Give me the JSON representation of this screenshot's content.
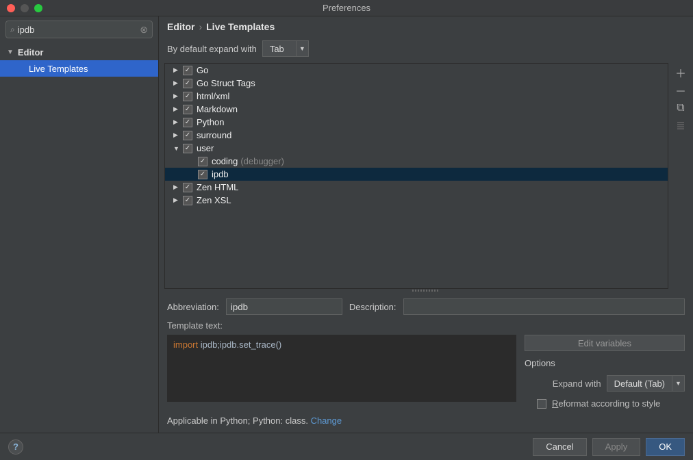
{
  "window": {
    "title": "Preferences"
  },
  "search": {
    "value": "ipdb",
    "placeholder": ""
  },
  "sidebar": {
    "group": "Editor",
    "items": [
      {
        "label": "Live Templates"
      }
    ]
  },
  "breadcrumb": {
    "root": "Editor",
    "leaf": "Live Templates"
  },
  "expand": {
    "label": "By default expand with",
    "value": "Tab"
  },
  "tree": {
    "groups": [
      {
        "label": "Go",
        "expanded": false
      },
      {
        "label": "Go Struct Tags",
        "expanded": false
      },
      {
        "label": "html/xml",
        "expanded": false
      },
      {
        "label": "Markdown",
        "expanded": false
      },
      {
        "label": "Python",
        "expanded": false
      },
      {
        "label": "surround",
        "expanded": false
      },
      {
        "label": "user",
        "expanded": true,
        "children": [
          {
            "label": "coding",
            "hint": "(debugger)",
            "selected": false
          },
          {
            "label": "ipdb",
            "hint": "",
            "selected": true
          }
        ]
      },
      {
        "label": "Zen HTML",
        "expanded": false
      },
      {
        "label": "Zen XSL",
        "expanded": false
      }
    ]
  },
  "form": {
    "abbrev_label": "Abbreviation:",
    "abbrev_value": "ipdb",
    "desc_label": "Description:",
    "desc_value": "",
    "template_label": "Template text:",
    "template_kw": "import",
    "template_rest": " ipdb;ipdb.set_trace()",
    "edit_vars": "Edit variables",
    "options_title": "Options",
    "expand_with_label": "Expand with",
    "expand_with_value": "Default (Tab)",
    "reformat_label_pre": "R",
    "reformat_label_rest": "eformat according to style"
  },
  "applicable": {
    "text": "Applicable in Python; Python: class. ",
    "link": "Change"
  },
  "footer": {
    "cancel": "Cancel",
    "apply": "Apply",
    "ok": "OK"
  }
}
